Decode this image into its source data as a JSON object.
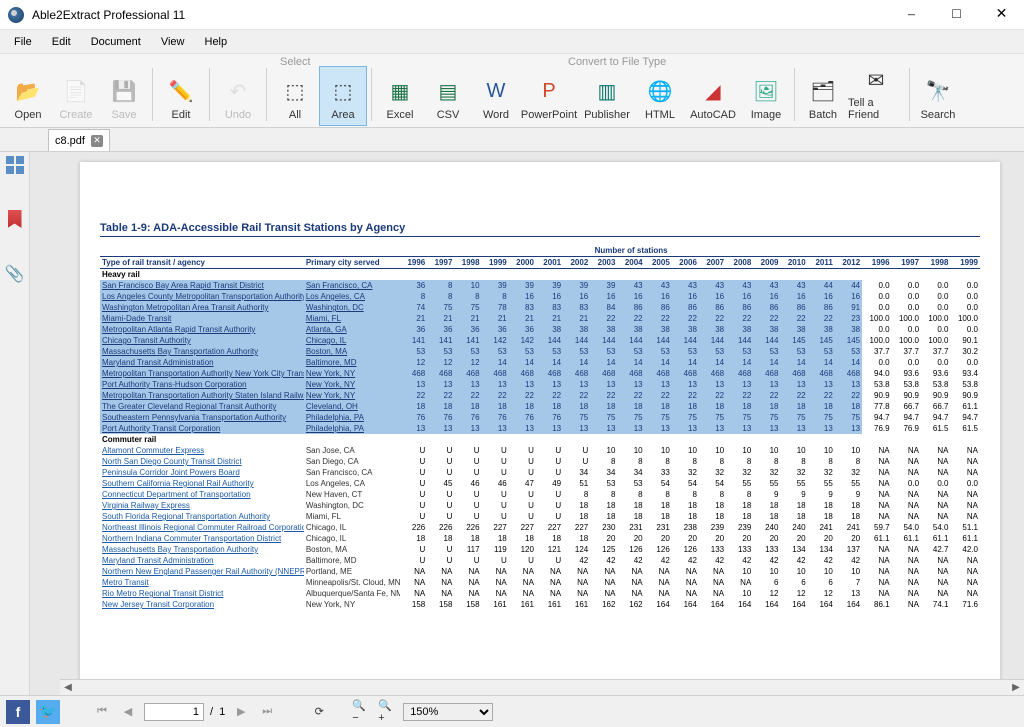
{
  "app": {
    "title": "Able2Extract Professional 11"
  },
  "menu": {
    "file": "File",
    "edit": "Edit",
    "document": "Document",
    "view": "View",
    "help": "Help"
  },
  "toolbar": {
    "groups": {
      "select": "Select",
      "convert": "Convert to File Type"
    },
    "open": "Open",
    "create": "Create",
    "save": "Save",
    "edit": "Edit",
    "undo": "Undo",
    "all": "All",
    "area": "Area",
    "excel": "Excel",
    "csv": "CSV",
    "word": "Word",
    "powerpoint": "PowerPoint",
    "publisher": "Publisher",
    "html": "HTML",
    "autocad": "AutoCAD",
    "image": "Image",
    "batch": "Batch",
    "tellfriend": "Tell a Friend",
    "search": "Search"
  },
  "tab": {
    "name": "c8.pdf"
  },
  "status": {
    "page_current": "1",
    "page_sep": "/",
    "page_total": "1",
    "zoom": "150%"
  },
  "doc": {
    "title": "Table 1-9:  ADA-Accessible Rail Transit Stations by Agency",
    "header_nos": "Number of stations",
    "col_agency": "Type of rail transit / agency",
    "col_city": "Primary city served",
    "years": [
      "1996",
      "1997",
      "1998",
      "1999",
      "2000",
      "2001",
      "2002",
      "2003",
      "2004",
      "2005",
      "2006",
      "2007",
      "2008",
      "2009",
      "2010",
      "2011",
      "2012"
    ],
    "na_years": [
      "1996",
      "1997",
      "1998",
      "1999"
    ],
    "groups": {
      "heavy": "Heavy rail",
      "commuter": "Commuter rail"
    },
    "heavy_rows": [
      {
        "a": "San Francisco Bay Area Rapid Transit District",
        "c": "San Francisco, CA",
        "v": [
          "36",
          "8",
          "10",
          "39",
          "39",
          "39",
          "39",
          "39",
          "43",
          "43",
          "43",
          "43",
          "43",
          "43",
          "43",
          "44",
          "44"
        ],
        "n": [
          "0.0",
          "0.0",
          "0.0",
          "0.0"
        ]
      },
      {
        "a": "Los Angeles County Metropolitan Transportation Authority",
        "c": "Los Angeles, CA",
        "v": [
          "8",
          "8",
          "8",
          "8",
          "16",
          "16",
          "16",
          "16",
          "16",
          "16",
          "16",
          "16",
          "16",
          "16",
          "16",
          "16",
          "16"
        ],
        "n": [
          "0.0",
          "0.0",
          "0.0",
          "0.0"
        ]
      },
      {
        "a": "Washington Metropolitan Area Transit Authority",
        "c": "Washington, DC",
        "v": [
          "74",
          "75",
          "75",
          "78",
          "83",
          "83",
          "83",
          "84",
          "86",
          "86",
          "86",
          "86",
          "86",
          "86",
          "86",
          "86",
          "91"
        ],
        "n": [
          "0.0",
          "0.0",
          "0.0",
          "0.0"
        ]
      },
      {
        "a": "Miami-Dade Transit",
        "c": "Miami, FL",
        "v": [
          "21",
          "21",
          "21",
          "21",
          "21",
          "21",
          "21",
          "22",
          "22",
          "22",
          "22",
          "22",
          "22",
          "22",
          "22",
          "22",
          "23"
        ],
        "n": [
          "100.0",
          "100.0",
          "100.0",
          "100.0"
        ]
      },
      {
        "a": "Metropolitan Atlanta Rapid Transit Authority",
        "c": "Atlanta, GA",
        "v": [
          "36",
          "36",
          "36",
          "36",
          "36",
          "38",
          "38",
          "38",
          "38",
          "38",
          "38",
          "38",
          "38",
          "38",
          "38",
          "38",
          "38"
        ],
        "n": [
          "0.0",
          "0.0",
          "0.0",
          "0.0"
        ]
      },
      {
        "a": "Chicago Transit Authority",
        "c": "Chicago, IL",
        "v": [
          "141",
          "141",
          "141",
          "142",
          "142",
          "144",
          "144",
          "144",
          "144",
          "144",
          "144",
          "144",
          "144",
          "144",
          "145",
          "145",
          "145"
        ],
        "n": [
          "100.0",
          "100.0",
          "100.0",
          "90.1"
        ]
      },
      {
        "a": "Massachusetts Bay Transportation Authority",
        "c": "Boston, MA",
        "v": [
          "53",
          "53",
          "53",
          "53",
          "53",
          "53",
          "53",
          "53",
          "53",
          "53",
          "53",
          "53",
          "53",
          "53",
          "53",
          "53",
          "53"
        ],
        "n": [
          "37.7",
          "37.7",
          "37.7",
          "30.2"
        ]
      },
      {
        "a": "Maryland Transit Administration",
        "c": "Baltimore, MD",
        "v": [
          "12",
          "12",
          "12",
          "14",
          "14",
          "14",
          "14",
          "14",
          "14",
          "14",
          "14",
          "14",
          "14",
          "14",
          "14",
          "14",
          "14"
        ],
        "n": [
          "0.0",
          "0.0",
          "0.0",
          "0.0"
        ]
      },
      {
        "a": "Metropolitan Transportation Authority New York City Transit",
        "c": "New York, NY",
        "v": [
          "468",
          "468",
          "468",
          "468",
          "468",
          "468",
          "468",
          "468",
          "468",
          "468",
          "468",
          "468",
          "468",
          "468",
          "468",
          "468",
          "468"
        ],
        "n": [
          "94.0",
          "93.6",
          "93.6",
          "93.4"
        ]
      },
      {
        "a": "Port Authority Trans-Hudson Corporation",
        "c": "New York, NY",
        "v": [
          "13",
          "13",
          "13",
          "13",
          "13",
          "13",
          "13",
          "13",
          "13",
          "13",
          "13",
          "13",
          "13",
          "13",
          "13",
          "13",
          "13"
        ],
        "n": [
          "53.8",
          "53.8",
          "53.8",
          "53.8"
        ]
      },
      {
        "a": "Metropolitan Transportation Authority Staten Island Railway",
        "c": "New York, NY",
        "v": [
          "22",
          "22",
          "22",
          "22",
          "22",
          "22",
          "22",
          "22",
          "22",
          "22",
          "22",
          "22",
          "22",
          "22",
          "22",
          "22",
          "22"
        ],
        "n": [
          "90.9",
          "90.9",
          "90.9",
          "90.9"
        ]
      },
      {
        "a": "The Greater Cleveland Regional Transit Authority",
        "c": "Cleveland, OH",
        "v": [
          "18",
          "18",
          "18",
          "18",
          "18",
          "18",
          "18",
          "18",
          "18",
          "18",
          "18",
          "18",
          "18",
          "18",
          "18",
          "18",
          "18"
        ],
        "n": [
          "77.8",
          "66.7",
          "66.7",
          "61.1"
        ]
      },
      {
        "a": "Southeastern Pennsylvania Transportation Authority",
        "c": "Philadelphia, PA",
        "v": [
          "76",
          "76",
          "76",
          "76",
          "76",
          "76",
          "75",
          "75",
          "75",
          "75",
          "75",
          "75",
          "75",
          "75",
          "75",
          "75",
          "75"
        ],
        "n": [
          "94.7",
          "94.7",
          "94.7",
          "94.7"
        ]
      },
      {
        "a": "Port Authority Transit Corporation",
        "c": "Philadelphia, PA",
        "v": [
          "13",
          "13",
          "13",
          "13",
          "13",
          "13",
          "13",
          "13",
          "13",
          "13",
          "13",
          "13",
          "13",
          "13",
          "13",
          "13",
          "13"
        ],
        "n": [
          "76.9",
          "76.9",
          "61.5",
          "61.5"
        ]
      }
    ],
    "commuter_rows": [
      {
        "a": "Altamont Commuter Express",
        "c": "San Jose, CA",
        "v": [
          "U",
          "U",
          "U",
          "U",
          "U",
          "U",
          "U",
          "10",
          "10",
          "10",
          "10",
          "10",
          "10",
          "10",
          "10",
          "10",
          "10"
        ],
        "n": [
          "NA",
          "NA",
          "NA",
          "NA"
        ]
      },
      {
        "a": "North San Diego County Transit District",
        "c": "San Diego, CA",
        "v": [
          "U",
          "U",
          "U",
          "U",
          "U",
          "U",
          "U",
          "8",
          "8",
          "8",
          "8",
          "8",
          "8",
          "8",
          "8",
          "8",
          "8"
        ],
        "n": [
          "NA",
          "NA",
          "NA",
          "NA"
        ]
      },
      {
        "a": "Peninsula Corridor Joint Powers Board",
        "c": "San Francisco, CA",
        "v": [
          "U",
          "U",
          "U",
          "U",
          "U",
          "U",
          "34",
          "34",
          "34",
          "33",
          "32",
          "32",
          "32",
          "32",
          "32",
          "32",
          "32"
        ],
        "n": [
          "NA",
          "NA",
          "NA",
          "NA"
        ]
      },
      {
        "a": "Southern California Regional Rail Authority",
        "c": "Los Angeles, CA",
        "v": [
          "U",
          "45",
          "46",
          "46",
          "47",
          "49",
          "51",
          "53",
          "53",
          "54",
          "54",
          "54",
          "55",
          "55",
          "55",
          "55",
          "55"
        ],
        "n": [
          "NA",
          "0.0",
          "0.0",
          "0.0"
        ]
      },
      {
        "a": "Connecticut Department of Transportation",
        "c": "New Haven, CT",
        "v": [
          "U",
          "U",
          "U",
          "U",
          "U",
          "U",
          "8",
          "8",
          "8",
          "8",
          "8",
          "8",
          "8",
          "9",
          "9",
          "9",
          "9"
        ],
        "n": [
          "NA",
          "NA",
          "NA",
          "NA"
        ]
      },
      {
        "a": "Virginia Railway Express",
        "c": "Washington, DC",
        "v": [
          "U",
          "U",
          "U",
          "U",
          "U",
          "U",
          "18",
          "18",
          "18",
          "18",
          "18",
          "18",
          "18",
          "18",
          "18",
          "18",
          "18"
        ],
        "n": [
          "NA",
          "NA",
          "NA",
          "NA"
        ]
      },
      {
        "a": "South Florida Regional Transportation Authority",
        "c": "Miami, FL",
        "v": [
          "U",
          "U",
          "U",
          "U",
          "U",
          "U",
          "18",
          "18",
          "18",
          "18",
          "18",
          "18",
          "18",
          "18",
          "18",
          "18",
          "18"
        ],
        "n": [
          "NA",
          "NA",
          "NA",
          "NA"
        ]
      },
      {
        "a": "Northeast Illinois Regional Commuter Railroad Corporation",
        "c": "Chicago, IL",
        "v": [
          "226",
          "226",
          "226",
          "227",
          "227",
          "227",
          "227",
          "230",
          "231",
          "231",
          "238",
          "239",
          "239",
          "240",
          "240",
          "241",
          "241"
        ],
        "n": [
          "59.7",
          "54.0",
          "54.0",
          "51.1"
        ]
      },
      {
        "a": "Northern Indiana Commuter Transportation District",
        "c": "Chicago, IL",
        "v": [
          "18",
          "18",
          "18",
          "18",
          "18",
          "18",
          "18",
          "20",
          "20",
          "20",
          "20",
          "20",
          "20",
          "20",
          "20",
          "20",
          "20"
        ],
        "n": [
          "61.1",
          "61.1",
          "61.1",
          "61.1"
        ]
      },
      {
        "a": "Massachusetts Bay Transportation Authority",
        "c": "Boston, MA",
        "v": [
          "U",
          "U",
          "117",
          "119",
          "120",
          "121",
          "124",
          "125",
          "126",
          "126",
          "126",
          "133",
          "133",
          "133",
          "134",
          "134",
          "137"
        ],
        "n": [
          "NA",
          "NA",
          "42.7",
          "42.0"
        ]
      },
      {
        "a": "Maryland Transit Administration",
        "c": "Baltimore, MD",
        "v": [
          "U",
          "U",
          "U",
          "U",
          "U",
          "U",
          "42",
          "42",
          "42",
          "42",
          "42",
          "42",
          "42",
          "42",
          "42",
          "42",
          "42"
        ],
        "n": [
          "NA",
          "NA",
          "NA",
          "NA"
        ]
      },
      {
        "a": "Northern New England Passenger Rail Authority (NNEPRA)",
        "c": "Portland, ME",
        "v": [
          "NA",
          "NA",
          "NA",
          "NA",
          "NA",
          "NA",
          "NA",
          "NA",
          "NA",
          "NA",
          "NA",
          "NA",
          "10",
          "10",
          "10",
          "10",
          "10"
        ],
        "n": [
          "NA",
          "NA",
          "NA",
          "NA"
        ]
      },
      {
        "a": "Metro Transit",
        "c": "Minneapolis/St. Cloud, MN",
        "v": [
          "NA",
          "NA",
          "NA",
          "NA",
          "NA",
          "NA",
          "NA",
          "NA",
          "NA",
          "NA",
          "NA",
          "NA",
          "NA",
          "6",
          "6",
          "6",
          "7"
        ],
        "n": [
          "NA",
          "NA",
          "NA",
          "NA"
        ]
      },
      {
        "a": "Rio Metro Regional Transit District",
        "c": "Albuquerque/Santa Fe, NM",
        "v": [
          "NA",
          "NA",
          "NA",
          "NA",
          "NA",
          "NA",
          "NA",
          "NA",
          "NA",
          "NA",
          "NA",
          "NA",
          "10",
          "12",
          "12",
          "12",
          "13"
        ],
        "n": [
          "NA",
          "NA",
          "NA",
          "NA"
        ]
      },
      {
        "a": "New Jersey Transit Corporation",
        "c": "New York, NY",
        "v": [
          "158",
          "158",
          "158",
          "161",
          "161",
          "161",
          "161",
          "162",
          "162",
          "164",
          "164",
          "164",
          "164",
          "164",
          "164",
          "164",
          "164"
        ],
        "n": [
          "86.1",
          "NA",
          "74.1",
          "71.6"
        ]
      }
    ]
  }
}
